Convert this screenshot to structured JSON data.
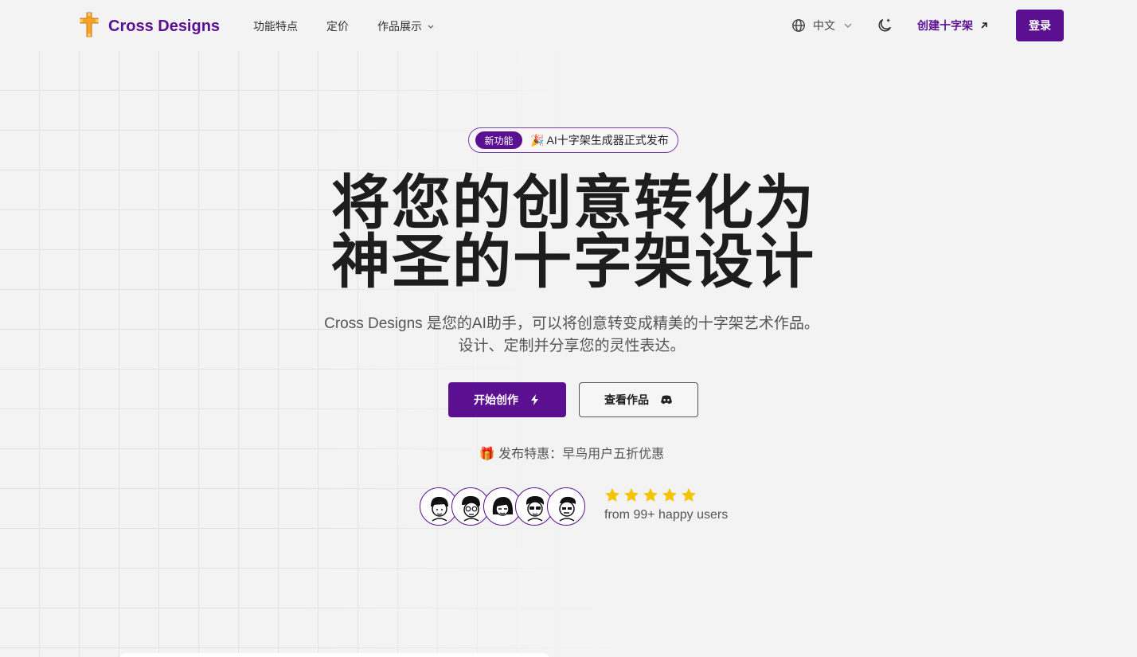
{
  "brand": {
    "name": "Cross Designs",
    "color": "#5b0f91",
    "logo_icon": "cross-icon",
    "logo_color": "#f6a12a"
  },
  "nav": {
    "items": [
      {
        "label": "功能特点"
      },
      {
        "label": "定价"
      },
      {
        "label": "作品展示",
        "dropdown": true
      }
    ]
  },
  "header_right": {
    "language": "中文",
    "create_label": "创建十字架",
    "login_label": "登录"
  },
  "hero": {
    "badge_pill": "新功能",
    "badge_text": "🎉 AI十字架生成器正式发布",
    "title_line1": "将您的创意转化为",
    "title_line2": "神圣的十字架设计",
    "subtitle_line1": "Cross Designs 是您的AI助手，可以将创意转变成精美的十字架艺术作品。",
    "subtitle_line2": "设计、定制并分享您的灵性表达。",
    "primary_button": "开始创作",
    "secondary_button": "查看作品",
    "promo": "🎁 发布特惠：早鸟用户五折优惠",
    "rating_stars": 5,
    "rating_text": "from 99+ happy users"
  },
  "colors": {
    "accent": "#5b0f91",
    "star": "#f5c400",
    "background": "#f3f3f3"
  }
}
